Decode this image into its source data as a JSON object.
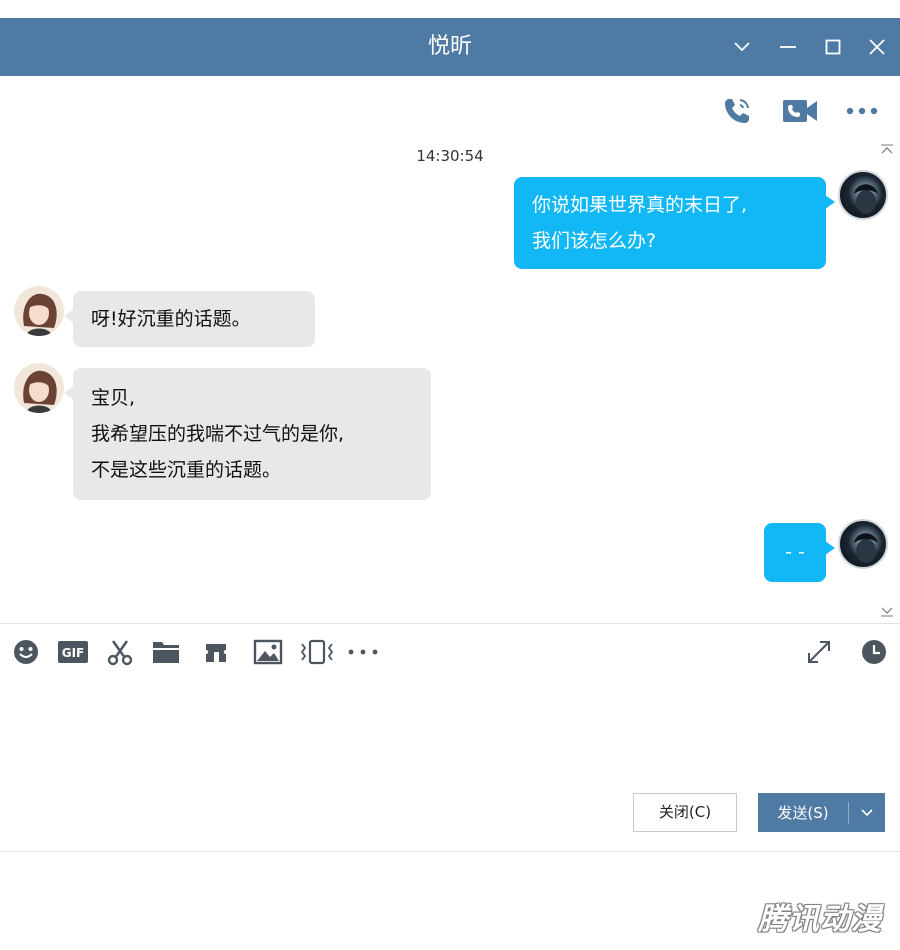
{
  "window": {
    "title": "悦昕",
    "controls": [
      "chevron-down-icon",
      "minimize-icon",
      "maximize-icon",
      "close-icon"
    ]
  },
  "header_actions": [
    "phone-icon",
    "video-call-icon",
    "more-icon"
  ],
  "chat": {
    "timestamp": "14:30:54",
    "messages": [
      {
        "sender": "me",
        "lines": [
          "你说如果世界真的末日了,",
          "我们该怎么办?"
        ]
      },
      {
        "sender": "other",
        "lines": [
          "呀!好沉重的话题。"
        ]
      },
      {
        "sender": "other",
        "lines": [
          "宝贝,",
          "我希望压的我喘不过气的是你,",
          "不是这些沉重的话题。"
        ]
      },
      {
        "sender": "me",
        "lines": [
          "- -"
        ]
      }
    ]
  },
  "toolbar": {
    "tools": [
      "emoji-icon",
      "gif-icon",
      "scissors-icon",
      "folder-icon",
      "ticket-icon",
      "image-icon",
      "shake-icon",
      "more-icon"
    ],
    "gif_label": "GIF",
    "right_tools": [
      "expand-icon",
      "history-icon"
    ]
  },
  "buttons": {
    "close_label": "关闭(C)",
    "send_label": "发送(S)"
  },
  "watermark": "腾讯动漫",
  "colors": {
    "titlebar": "#4f7aa3",
    "my_bubble": "#12b7f5",
    "other_bubble": "#e8e8e8"
  }
}
